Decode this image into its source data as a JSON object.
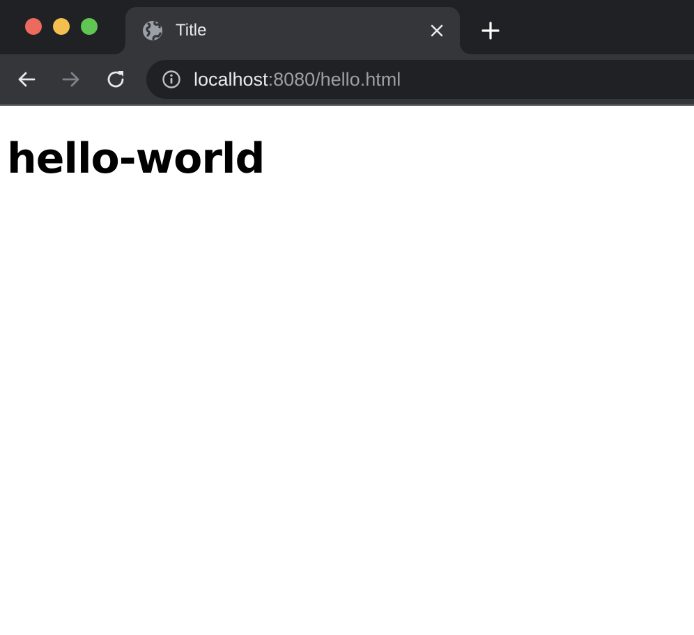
{
  "window": {
    "traffic_lights": [
      {
        "name": "close",
        "color": "#ed6a5e"
      },
      {
        "name": "minimize",
        "color": "#f5bf4f"
      },
      {
        "name": "maximize",
        "color": "#61c554"
      }
    ]
  },
  "tab": {
    "title": "Title",
    "favicon": "globe-icon",
    "close_icon": "close-icon"
  },
  "new_tab_icon": "plus-icon",
  "toolbar": {
    "back_icon": "back-arrow-icon",
    "forward_icon": "forward-arrow-icon",
    "reload_icon": "reload-icon",
    "site_info_icon": "info-icon",
    "url_host": "localhost",
    "url_rest": ":8080/hello.html"
  },
  "page": {
    "heading": "hello-world"
  },
  "colors": {
    "tabstrip": "#202124",
    "toolbar": "#35363a",
    "omnibox": "#202124",
    "content_bg": "#ffffff",
    "heading": "#000000"
  }
}
